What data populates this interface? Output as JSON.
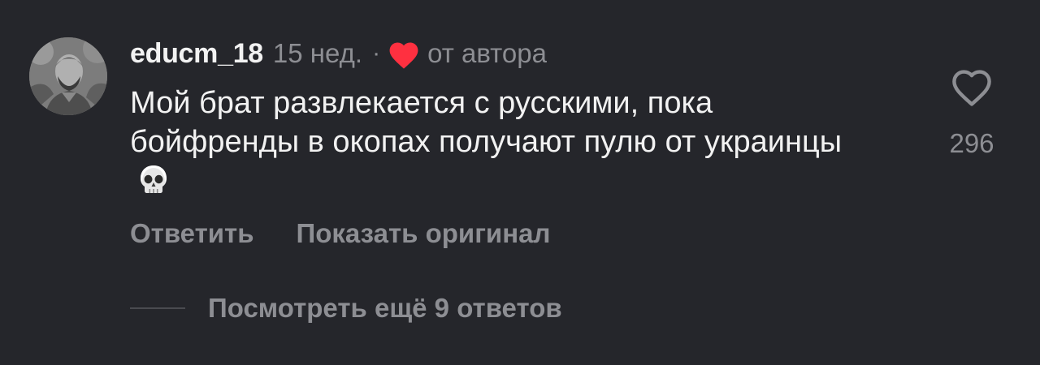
{
  "comment": {
    "username": "educm_18",
    "time": "15 нед.",
    "separator": "·",
    "author_like_label": "от автора",
    "text": "Мой брат развлекается с русскими, пока бойфренды в окопах получают пулю от украинцы",
    "emoji_icon": "skull-icon",
    "like_count": "296",
    "colors": {
      "background": "#25262b",
      "heart_red": "#ff3040",
      "text_primary": "#f2f2f2",
      "text_secondary": "#8d8e93"
    }
  },
  "actions": {
    "reply_label": "Ответить",
    "show_original_label": "Показать оригинал"
  },
  "replies": {
    "label": "Посмотреть ещё 9 ответов"
  }
}
